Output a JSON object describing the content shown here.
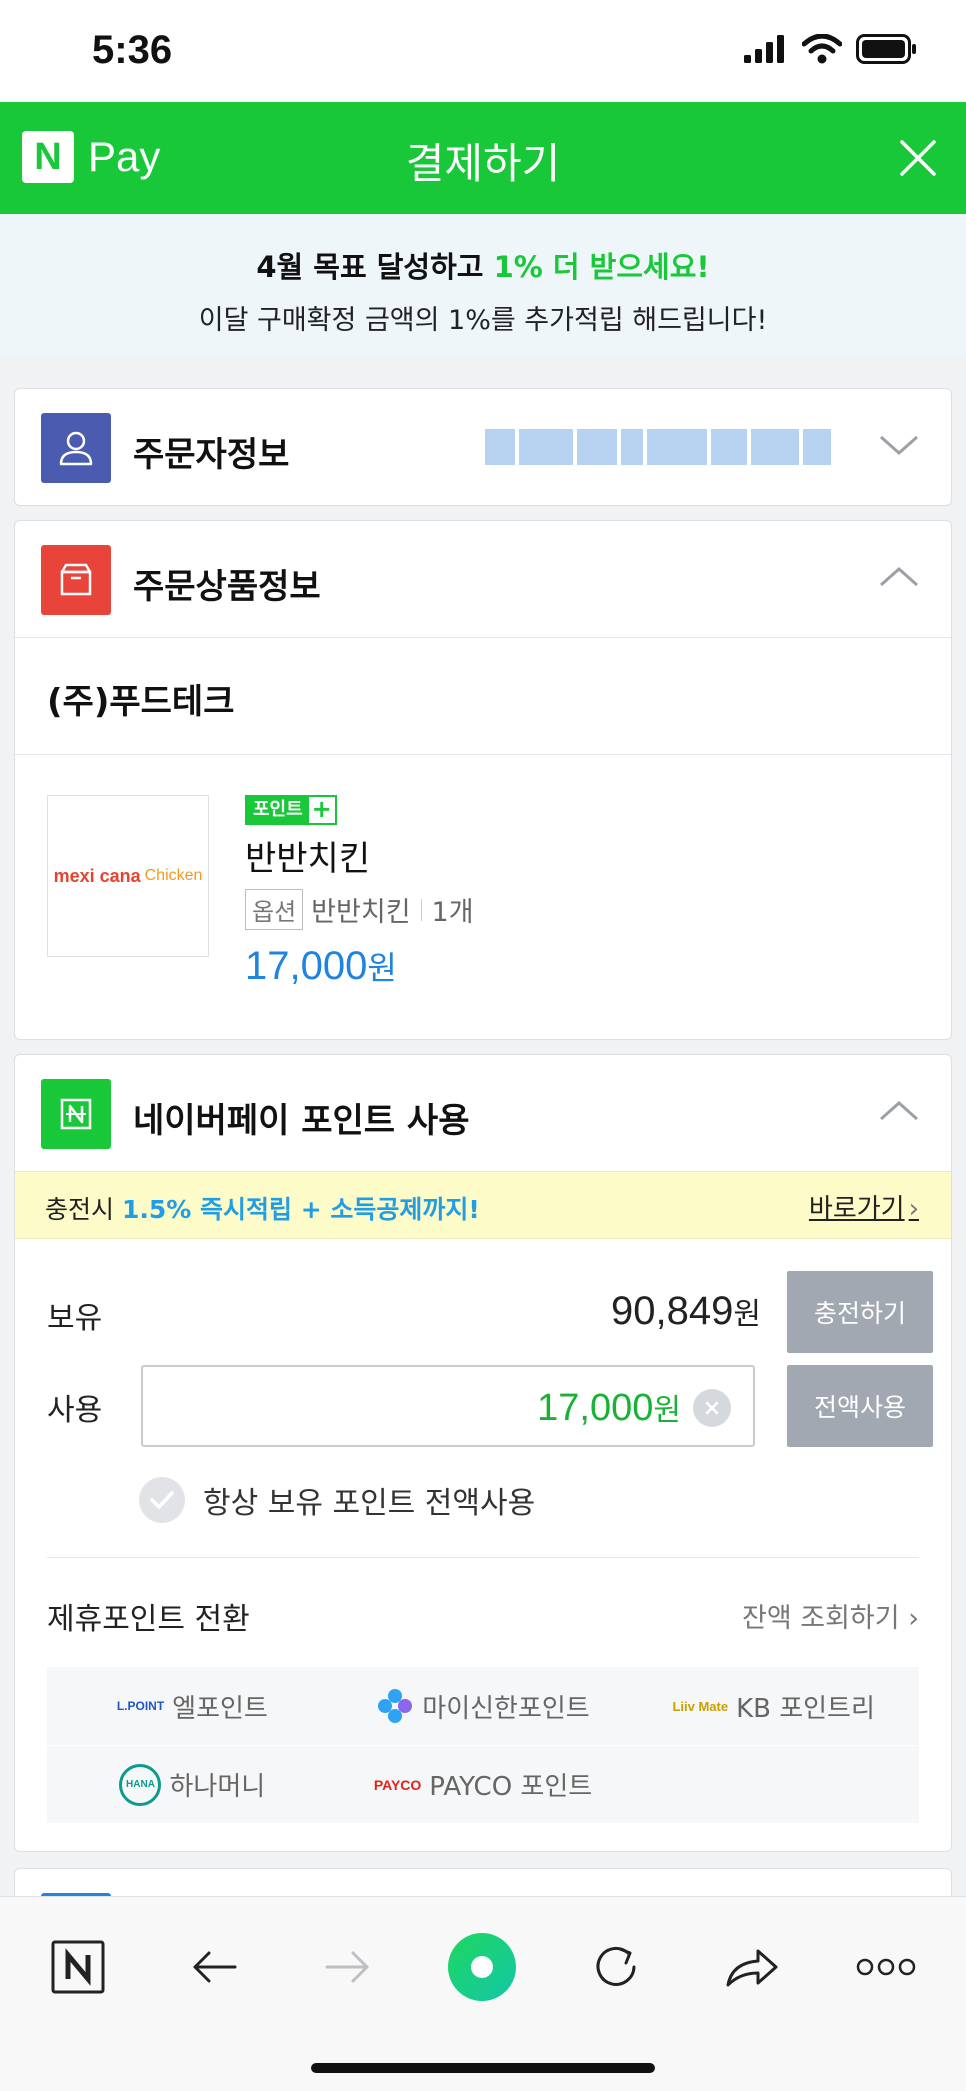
{
  "status_bar": {
    "time": "5:36"
  },
  "header": {
    "logo_letter": "N",
    "logo_text": "Pay",
    "title": "결제하기"
  },
  "promo": {
    "line1_prefix": "4월 목표 달성하고 ",
    "line1_highlight": "1% 더 받으세요!",
    "line2": "이달 구매확정 금액의 1%를 추가적립 해드립니다!"
  },
  "buyer_section": {
    "title": "주문자정보",
    "icon": "person-icon",
    "color": "#4b5bb0"
  },
  "product_section": {
    "title": "주문상품정보",
    "icon": "box-icon",
    "color": "#e8443a",
    "seller": "(주)푸드테크",
    "item": {
      "badge_label": "포인트",
      "badge_plus": "+",
      "brand_logo": "mexi cana",
      "brand_logo_sub": "Chicken",
      "name": "반반치킨",
      "option_tag": "옵션",
      "option_value": "반반치킨",
      "quantity": "1개",
      "price": "17,000",
      "currency": "원"
    }
  },
  "point_section": {
    "title": "네이버페이 포인트 사용",
    "icon": "naver-point-icon",
    "charge_prefix": "충전시 ",
    "charge_highlight": "1.5% 즉시적립 + 소득공제까지!",
    "charge_link": "바로가기",
    "hold_label": "보유",
    "hold_value": "90,849",
    "hold_unit": "원",
    "charge_button": "충전하기",
    "use_label": "사용",
    "use_value": "17,000",
    "use_unit": "원",
    "use_all_button": "전액사용",
    "always_use_label": "항상 보유 포인트 전액사용",
    "always_use_checked": false
  },
  "partner_points": {
    "title": "제휴포인트 전환",
    "balance_link": "잔액 조회하기",
    "items": [
      {
        "logo": "L.POINT",
        "label": "엘포인트",
        "color": "#1e57c8"
      },
      {
        "logo": "",
        "label": "마이신한포인트",
        "color": "#2ea3f2"
      },
      {
        "logo": "Liiv Mate",
        "label": "KB 포인트리",
        "color": "#f4b400"
      },
      {
        "logo": "HANA",
        "label": "하나머니",
        "color": "#0e9a8f"
      },
      {
        "logo": "PAYCO",
        "label": "PAYCO 포인트",
        "color": "#e2231a"
      }
    ]
  },
  "bottom_nav": [
    "naver-home-icon",
    "back-icon",
    "forward-icon",
    "green-dot-icon",
    "refresh-icon",
    "share-icon",
    "more-icon"
  ]
}
